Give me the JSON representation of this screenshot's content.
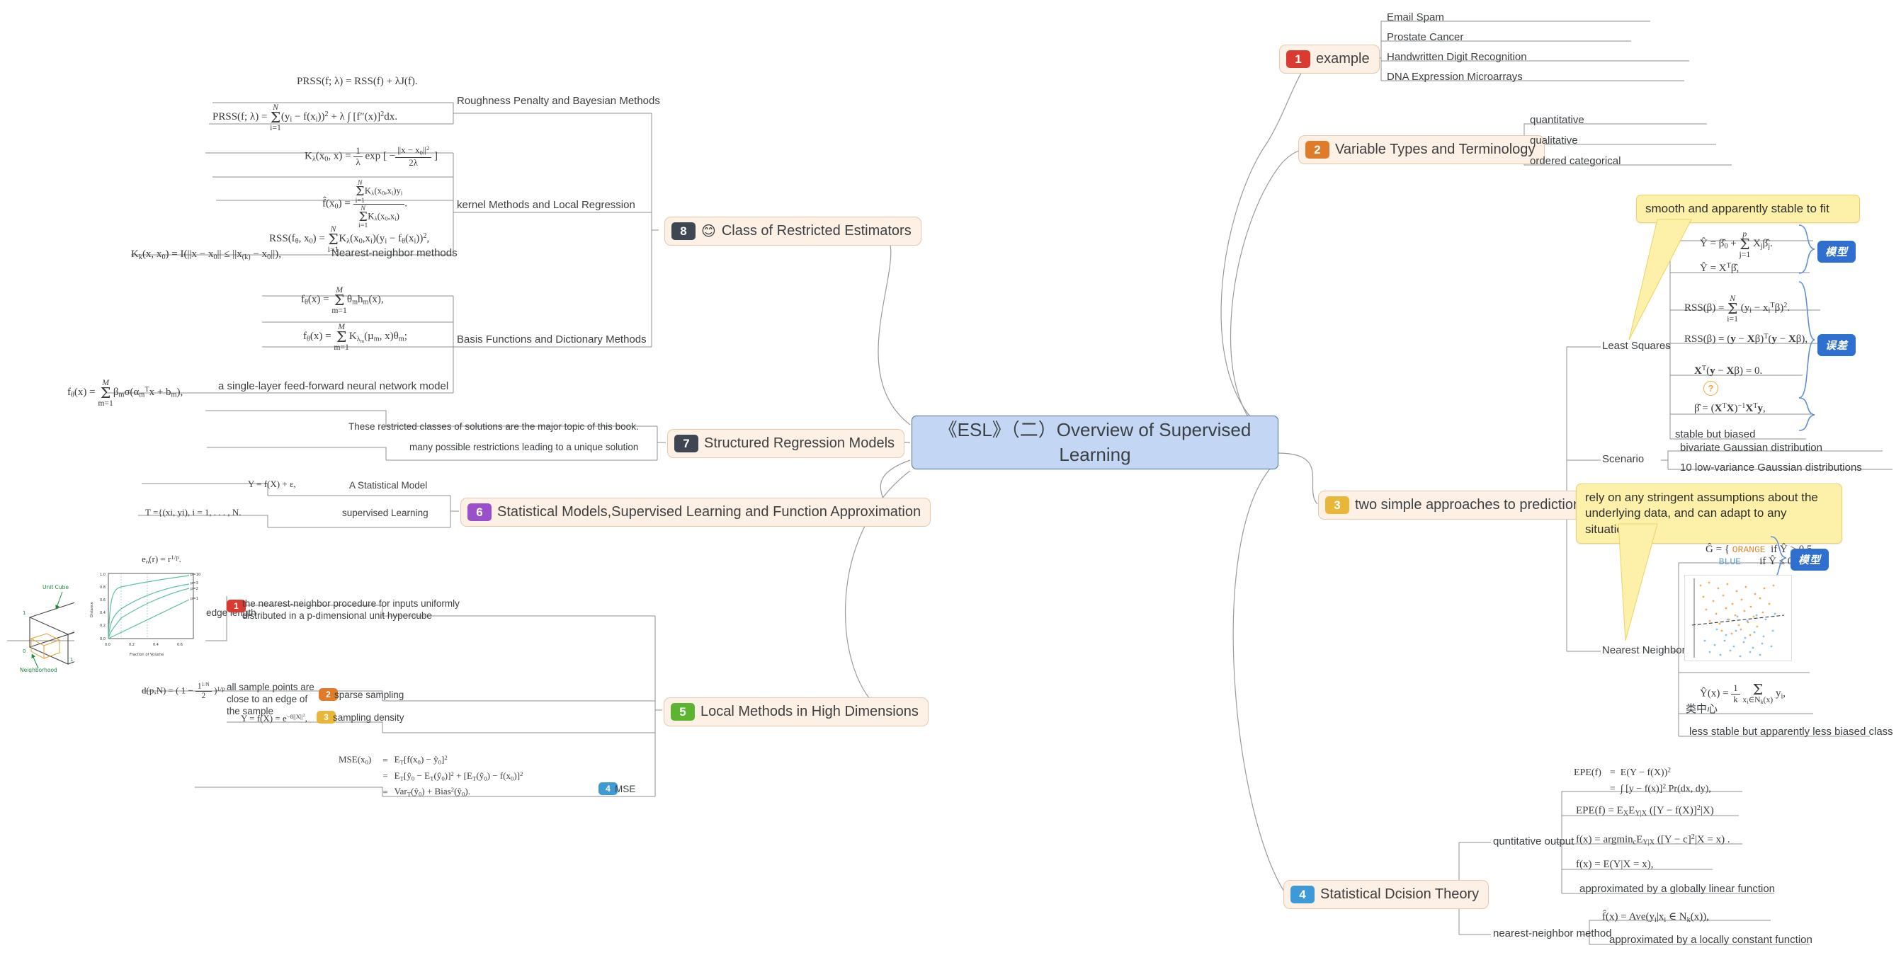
{
  "central": {
    "title": "《ESL》（二）Overview of Supervised Learning"
  },
  "colors": {
    "central_fill": "#c3d7f5",
    "central_border": "#4a6fa5",
    "topic_fill": "#fdf0e4",
    "topic_border": "#e3c9ad",
    "callout_fill": "#fdf0a8",
    "callout_border": "#e8d36a",
    "tag_blue": "#2f6fd0",
    "badge_red": "#d93b30",
    "badge_orange": "#e07b2a",
    "badge_yellow": "#e8b73a",
    "badge_blue": "#3d9ad6",
    "badge_green": "#5cb531",
    "badge_purple": "#9b4fc8",
    "badge_dark": "#3d4652",
    "arrow_red": "#a52a2a",
    "line_gray": "#9a9a9a"
  },
  "topics": {
    "t1": {
      "num": "1",
      "label": "example",
      "badge_color": "#d93b30",
      "children": [
        "Email Spam",
        "Prostate Cancer",
        "Handwritten Digit Recognition",
        "DNA Expression Microarrays"
      ]
    },
    "t2": {
      "num": "2",
      "label": "Variable Types and Terminology",
      "badge_color": "#e07b2a",
      "children": [
        "quantitative",
        "qualitative",
        "ordered categorical"
      ]
    },
    "t3": {
      "num": "3",
      "label": "two simple approaches to prediction",
      "badge_color": "#e8b73a",
      "groups": [
        "Least Squares",
        "Scenario",
        "Nearest Neighbors"
      ]
    },
    "t4": {
      "num": "4",
      "label": "Statistical Dcision Theory",
      "badge_color": "#3d9ad6",
      "groups": [
        "quntitative output",
        "nearest-neighbor method"
      ]
    },
    "t5": {
      "num": "5",
      "label": "Local Methods in High Dimensions",
      "badge_color": "#5cb531"
    },
    "t6": {
      "num": "6",
      "label": "Statistical Models,Supervised Learning and Function Approximation",
      "badge_color": "#9b4fc8"
    },
    "t7": {
      "num": "7",
      "label": "Structured Regression Models",
      "badge_color": "#3d4652"
    },
    "t8": {
      "num": "8",
      "label": "Class of Restricted Estimators",
      "badge_color": "#3d4652",
      "emoji": "😊"
    }
  },
  "least_squares": {
    "label": "Least Squares",
    "callout": "smooth and apparently stable to fit",
    "note": "stable but biased",
    "tag_model": "模型",
    "tag_error": "误差"
  },
  "scenario": {
    "label": "Scenario",
    "items": [
      "bivariate Gaussian distribution",
      "10 low-variance Gaussian distributions"
    ]
  },
  "nearest_neighbors": {
    "label": "Nearest Neighbors",
    "callout": "rely on any stringent assumptions about the underlying data, and can adapt to any situation",
    "tag_model": "模型",
    "class_center": "类中心",
    "note": "less stable but apparently less biased class"
  },
  "decision_theory": {
    "quantitative_label": "quntitative output",
    "quantitative_note": "approximated by a globally linear function",
    "nn_label": "nearest-neighbor method",
    "nn_note": "approximated by a locally constant function"
  },
  "restricted_estimators": {
    "groups": [
      "Roughness Penalty and Bayesian Methods",
      "kernel Methods and Local Regression",
      "Nearest-neighbor methods",
      "Basis Functions and Dictionary Methods",
      "a single-layer feed-forward neural network model"
    ]
  },
  "structured_regression": {
    "items": [
      "These restricted classes of solutions are the major topic of this book.",
      "many possible restrictions leading to a unique solution"
    ]
  },
  "statistical_models": {
    "items": [
      "A Statistical Model",
      "supervised Learning"
    ],
    "formulas": [
      "Y = f(X) + ε,",
      "T ={(xi, yi), i = 1, . . . , N."
    ]
  },
  "high_dimensions": {
    "edge_length_label": "the expected edge length",
    "sub1": {
      "num": "1",
      "color": "#d93b30",
      "text": "the nearest-neighbor procedure for inputs uniformly distributed in a p-dimensional unit hypercube"
    },
    "sub2": {
      "num": "2",
      "color": "#e07b2a",
      "text": "sparse sampling",
      "note": "all sample points are close to an edge of the sample"
    },
    "sub3": {
      "num": "3",
      "color": "#e8b73a",
      "text": "sampling density"
    },
    "sub4": {
      "num": "4",
      "color": "#3d9ad6",
      "text": "MSE"
    }
  },
  "chart_data": {
    "type": "line",
    "title": "",
    "xlabel": "Fraction of Volume",
    "ylabel": "Distance",
    "xlim": [
      0.0,
      0.65
    ],
    "ylim": [
      0.0,
      1.0
    ],
    "xticks": [
      "0.0",
      "0.2",
      "0.4",
      "0.6"
    ],
    "yticks": [
      "0.0",
      "0.2",
      "0.4",
      "0.6",
      "0.8",
      "1.0"
    ],
    "vlines": [
      0.1,
      0.3
    ],
    "series": [
      {
        "name": "p=10",
        "values": [
          [
            0.0,
            0.0
          ],
          [
            0.02,
            0.68
          ],
          [
            0.05,
            0.74
          ],
          [
            0.1,
            0.79
          ],
          [
            0.2,
            0.85
          ],
          [
            0.3,
            0.885
          ],
          [
            0.4,
            0.91
          ],
          [
            0.5,
            0.93
          ],
          [
            0.6,
            0.95
          ]
        ]
      },
      {
        "name": "p=3",
        "values": [
          [
            0.0,
            0.0
          ],
          [
            0.02,
            0.27
          ],
          [
            0.05,
            0.37
          ],
          [
            0.1,
            0.46
          ],
          [
            0.2,
            0.585
          ],
          [
            0.3,
            0.67
          ],
          [
            0.4,
            0.74
          ],
          [
            0.5,
            0.79
          ],
          [
            0.6,
            0.84
          ]
        ]
      },
      {
        "name": "p=2",
        "values": [
          [
            0.0,
            0.0
          ],
          [
            0.02,
            0.14
          ],
          [
            0.05,
            0.22
          ],
          [
            0.1,
            0.32
          ],
          [
            0.2,
            0.45
          ],
          [
            0.3,
            0.55
          ],
          [
            0.4,
            0.63
          ],
          [
            0.5,
            0.71
          ],
          [
            0.6,
            0.775
          ]
        ]
      },
      {
        "name": "p=1",
        "values": [
          [
            0.0,
            0.0
          ],
          [
            0.05,
            0.05
          ],
          [
            0.1,
            0.1
          ],
          [
            0.2,
            0.2
          ],
          [
            0.3,
            0.3
          ],
          [
            0.4,
            0.4
          ],
          [
            0.5,
            0.5
          ],
          [
            0.6,
            0.6
          ]
        ]
      }
    ],
    "color": "#5cbfa0"
  },
  "cube_diagram": {
    "label_top": "Unit Cube",
    "label_bottom": "Neighborhood",
    "axis_labels": [
      "1",
      "0",
      "1"
    ]
  },
  "scatter_plot": {
    "type": "scatter",
    "orange": "#e8a23c",
    "blue": "#6fb7e8",
    "boundary": "linear decision boundary"
  }
}
